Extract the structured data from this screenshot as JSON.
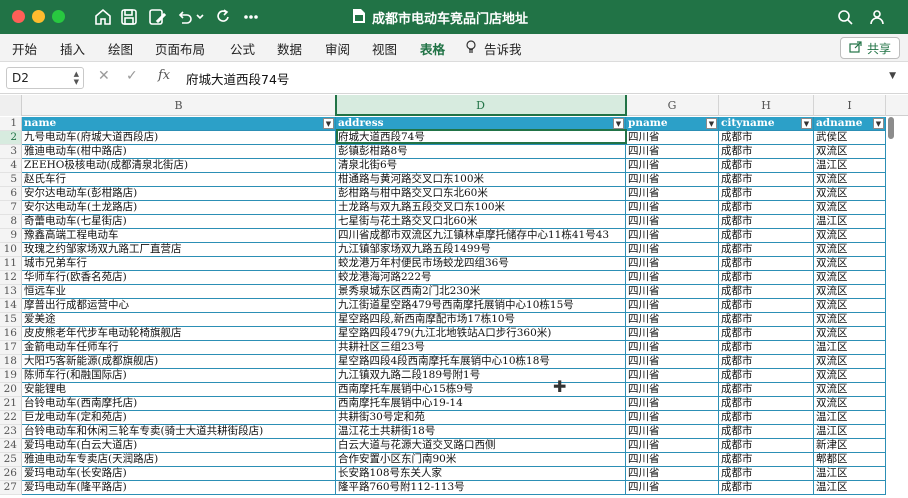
{
  "window": {
    "title": "成都市电动车竞品门店地址"
  },
  "ribbon": {
    "tabs": [
      "开始",
      "插入",
      "绘图",
      "页面布局",
      "公式",
      "数据",
      "审阅",
      "视图",
      "表格",
      "告诉我"
    ],
    "active_tab": "表格",
    "share_label": "共享"
  },
  "formula_bar": {
    "cell_ref": "D2",
    "fx_label": "fx",
    "value": "府城大道西段74号"
  },
  "grid": {
    "col_headers": [
      "B",
      "D",
      "G",
      "H",
      "I"
    ],
    "selected_col": "D",
    "row_numbers": [
      1,
      2,
      3,
      4,
      5,
      6,
      7,
      8,
      9,
      10,
      11,
      12,
      13,
      14,
      15,
      16,
      17,
      18,
      19,
      20,
      21,
      22,
      23,
      24,
      25,
      26,
      27
    ],
    "selected_row": 2,
    "header": [
      "name",
      "address",
      "pname",
      "cityname",
      "adname"
    ],
    "rows": [
      [
        "九号电动车(府城大道西段店)",
        "府城大道西段74号",
        "四川省",
        "成都市",
        "武侯区"
      ],
      [
        "雅迪电动车(柑中路店)",
        "彭镇彭柑路8号",
        "四川省",
        "成都市",
        "双流区"
      ],
      [
        "ZEEHO极核电动(成都清泉北街店)",
        "清泉北街6号",
        "四川省",
        "成都市",
        "温江区"
      ],
      [
        "赵氏车行",
        "柑通路与黄河路交叉口东100米",
        "四川省",
        "成都市",
        "双流区"
      ],
      [
        "安尔达电动车(彭柑路店)",
        "彭柑路与柑中路交叉口东北60米",
        "四川省",
        "成都市",
        "双流区"
      ],
      [
        "安尔达电动车(土龙路店)",
        "土龙路与双九路五段交叉口东100米",
        "四川省",
        "成都市",
        "双流区"
      ],
      [
        "奇蕾电动车(七星街店)",
        "七星街与花土路交叉口北60米",
        "四川省",
        "成都市",
        "温江区"
      ],
      [
        "豫鑫高端工程电动车",
        "四川省成都市双流区九江镇林卓摩托储存中心11栋41号43",
        "四川省",
        "成都市",
        "双流区"
      ],
      [
        "玫瑰之约邹家场双九路工厂直营店",
        "九江镇邹家场双九路五段1499号",
        "四川省",
        "成都市",
        "双流区"
      ],
      [
        "城市兄弟车行",
        "蛟龙港万年村便民市场蛟龙四组36号",
        "四川省",
        "成都市",
        "双流区"
      ],
      [
        "华师车行(欧香名苑店)",
        "蛟龙港海河路222号",
        "四川省",
        "成都市",
        "双流区"
      ],
      [
        "恒远车业",
        "景秀泉城东区西南2门北230米",
        "四川省",
        "成都市",
        "双流区"
      ],
      [
        "摩普出行成都运营中心",
        "九江街道星空路479号西南摩托展销中心10栋15号",
        "四川省",
        "成都市",
        "双流区"
      ],
      [
        "爱美途",
        "星空路四段,新西南摩配市场17栋10号",
        "四川省",
        "成都市",
        "双流区"
      ],
      [
        "皮皮熊老年代步车电动轮椅旗舰店",
        "星空路四段479(九江北地铁站A口步行360米)",
        "四川省",
        "成都市",
        "双流区"
      ],
      [
        "金箭电动车任师车行",
        "共耕社区三组23号",
        "四川省",
        "成都市",
        "温江区"
      ],
      [
        "大阳巧客新能源(成都旗舰店)",
        "星空路四段4段西南摩托车展销中心10栋18号",
        "四川省",
        "成都市",
        "双流区"
      ],
      [
        "陈师车行(和融国际店)",
        "九江镇双九路二段189号附1号",
        "四川省",
        "成都市",
        "双流区"
      ],
      [
        "安能锂电",
        "西南摩托车展销中心15栋9号",
        "四川省",
        "成都市",
        "双流区"
      ],
      [
        "台铃电动车(西南摩托店)",
        "西南摩托车展销中心19-14",
        "四川省",
        "成都市",
        "双流区"
      ],
      [
        "巨龙电动车(定和苑店)",
        "共耕街30号定和苑",
        "四川省",
        "成都市",
        "温江区"
      ],
      [
        "台铃电动车和休闲三轮车专卖(骑士大道共耕街段店)",
        "温江花土共耕街18号",
        "四川省",
        "成都市",
        "温江区"
      ],
      [
        "爱玛电动车(白云大道店)",
        "白云大道与花源大道交叉路口西侧",
        "四川省",
        "成都市",
        "新津区"
      ],
      [
        "雅迪电动车专卖店(天润路店)",
        "合作安置小区东门南90米",
        "四川省",
        "成都市",
        "郫都区"
      ],
      [
        "爱玛电动车(长安路店)",
        "长安路108号东关人家",
        "四川省",
        "成都市",
        "温江区"
      ],
      [
        "爱玛电动车(隆平路店)",
        "隆平路760号附112-113号",
        "四川省",
        "成都市",
        "温江区"
      ]
    ]
  },
  "icons": [
    "home-icon",
    "save-icon",
    "edit-save-icon",
    "undo-icon",
    "redo-icon",
    "more-icon",
    "document-icon",
    "search-icon",
    "share-icon",
    "lightbulb-icon"
  ],
  "colors": {
    "accent": "#217346",
    "table_header": "#2ca0c8",
    "table_border": "#2c8fb5"
  }
}
